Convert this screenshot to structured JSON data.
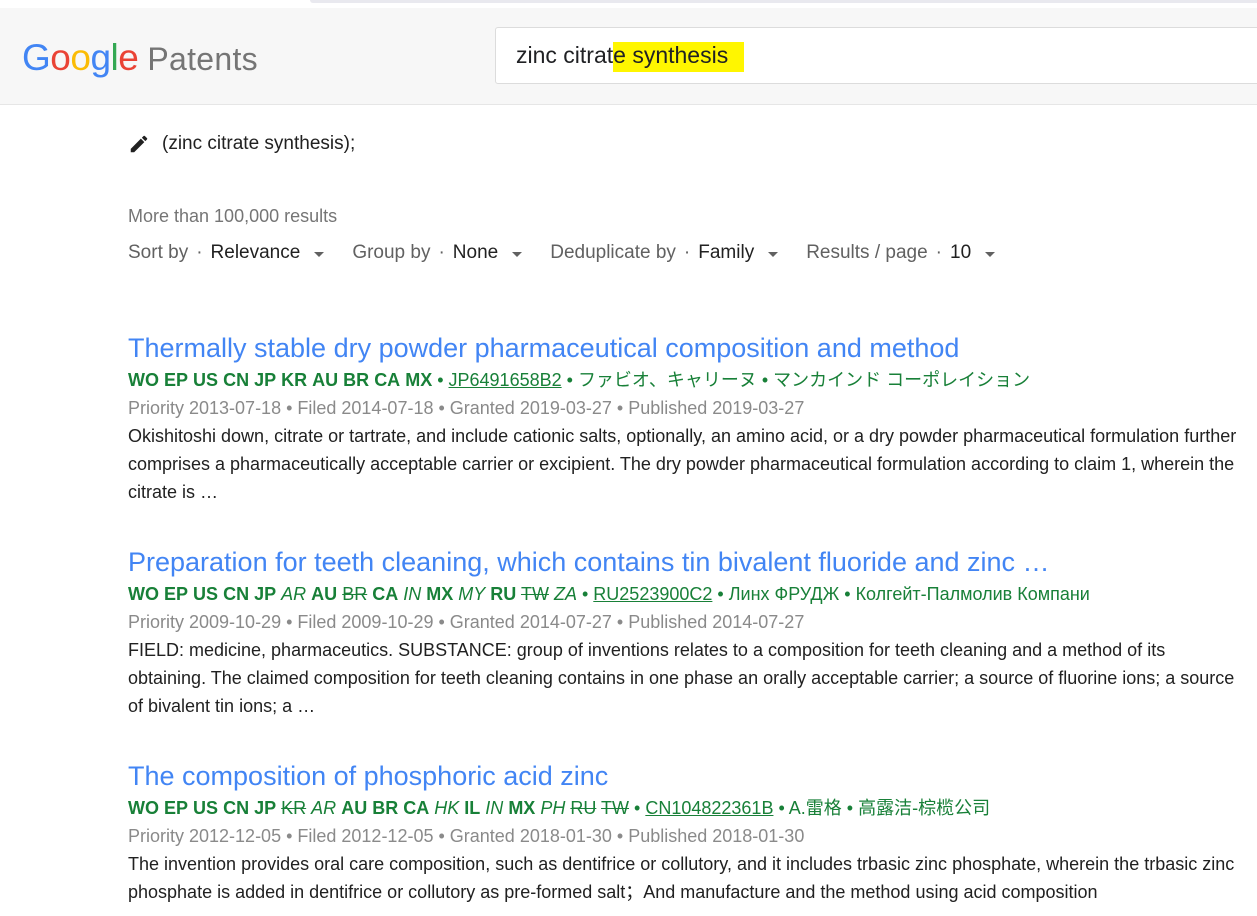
{
  "header": {
    "logo_text": "Google",
    "product": "Patents",
    "search_prefix": "zinc citrat",
    "search_highlight": "e synthesis"
  },
  "query_line": "(zinc citrate synthesis);",
  "results_count": "More than 100,000 results",
  "options": [
    {
      "label": "Sort by",
      "value": "Relevance"
    },
    {
      "label": "Group by",
      "value": "None"
    },
    {
      "label": "Deduplicate by",
      "value": "Family"
    },
    {
      "label": "Results / page",
      "value": "10"
    }
  ],
  "results": [
    {
      "title": "Thermally stable dry powder pharmaceutical composition and method",
      "countries": [
        {
          "code": "WO",
          "style": "normal"
        },
        {
          "code": "EP",
          "style": "normal"
        },
        {
          "code": "US",
          "style": "normal"
        },
        {
          "code": "CN",
          "style": "normal"
        },
        {
          "code": "JP",
          "style": "normal"
        },
        {
          "code": "KR",
          "style": "normal"
        },
        {
          "code": "AU",
          "style": "normal"
        },
        {
          "code": "BR",
          "style": "normal"
        },
        {
          "code": "CA",
          "style": "normal"
        },
        {
          "code": "MX",
          "style": "normal"
        }
      ],
      "pub_number": "JP6491658B2",
      "assignees": [
        "ファビオ、キャリーヌ",
        "マンカインド コーポレイション"
      ],
      "dates": "Priority 2013-07-18 • Filed 2014-07-18 • Granted 2019-03-27 • Published 2019-03-27",
      "snippet": "Okishitoshi down, citrate or tartrate, and include cationic salts, optionally, an amino acid, or a dry powder pharmaceutical formulation further comprises a pharmaceutically acceptable carrier or excipient. The dry powder pharmaceutical formulation according to claim 1, wherein the citrate is …"
    },
    {
      "title": "Preparation for teeth cleaning, which contains tin bivalent fluoride and zinc …",
      "countries": [
        {
          "code": "WO",
          "style": "normal"
        },
        {
          "code": "EP",
          "style": "normal"
        },
        {
          "code": "US",
          "style": "normal"
        },
        {
          "code": "CN",
          "style": "normal"
        },
        {
          "code": "JP",
          "style": "normal"
        },
        {
          "code": "AR",
          "style": "it"
        },
        {
          "code": "AU",
          "style": "normal"
        },
        {
          "code": "BR",
          "style": "strike"
        },
        {
          "code": "CA",
          "style": "normal"
        },
        {
          "code": "IN",
          "style": "it"
        },
        {
          "code": "MX",
          "style": "normal"
        },
        {
          "code": "MY",
          "style": "it"
        },
        {
          "code": "RU",
          "style": "normal"
        },
        {
          "code": "TW",
          "style": "strike"
        },
        {
          "code": "ZA",
          "style": "it"
        }
      ],
      "pub_number": "RU2523900C2",
      "assignees": [
        "Линх ФРУДЖ",
        "Колгейт-Палмолив Компани"
      ],
      "dates": "Priority 2009-10-29 • Filed 2009-10-29 • Granted 2014-07-27 • Published 2014-07-27",
      "snippet": "FIELD: medicine, pharmaceutics. SUBSTANCE: group of inventions relates to a composition for teeth cleaning and a method of its obtaining. The claimed composition for teeth cleaning contains in one phase an orally acceptable carrier; a source of fluorine ions; a source of bivalent tin ions; a …"
    },
    {
      "title": "The composition of phosphoric acid zinc",
      "countries": [
        {
          "code": "WO",
          "style": "normal"
        },
        {
          "code": "EP",
          "style": "normal"
        },
        {
          "code": "US",
          "style": "normal"
        },
        {
          "code": "CN",
          "style": "normal"
        },
        {
          "code": "JP",
          "style": "normal"
        },
        {
          "code": "KR",
          "style": "strike"
        },
        {
          "code": "AR",
          "style": "it"
        },
        {
          "code": "AU",
          "style": "normal"
        },
        {
          "code": "BR",
          "style": "normal"
        },
        {
          "code": "CA",
          "style": "normal"
        },
        {
          "code": "HK",
          "style": "it"
        },
        {
          "code": "IL",
          "style": "normal"
        },
        {
          "code": "IN",
          "style": "it"
        },
        {
          "code": "MX",
          "style": "normal"
        },
        {
          "code": "PH",
          "style": "it"
        },
        {
          "code": "RU",
          "style": "strike"
        },
        {
          "code": "TW",
          "style": "strike"
        }
      ],
      "pub_number": "CN104822361B",
      "assignees": [
        "A.雷格",
        "高露洁-棕榄公司"
      ],
      "dates": "Priority 2012-12-05 • Filed 2012-12-05 • Granted 2018-01-30 • Published 2018-01-30",
      "snippet": "The invention provides oral care composition, such as dentifrice or collutory, and it includes trbasic zinc phosphate, wherein the trbasic zinc phosphate is added in dentifrice or collutory as pre-formed salt；And manufacture and the method using acid composition"
    }
  ]
}
